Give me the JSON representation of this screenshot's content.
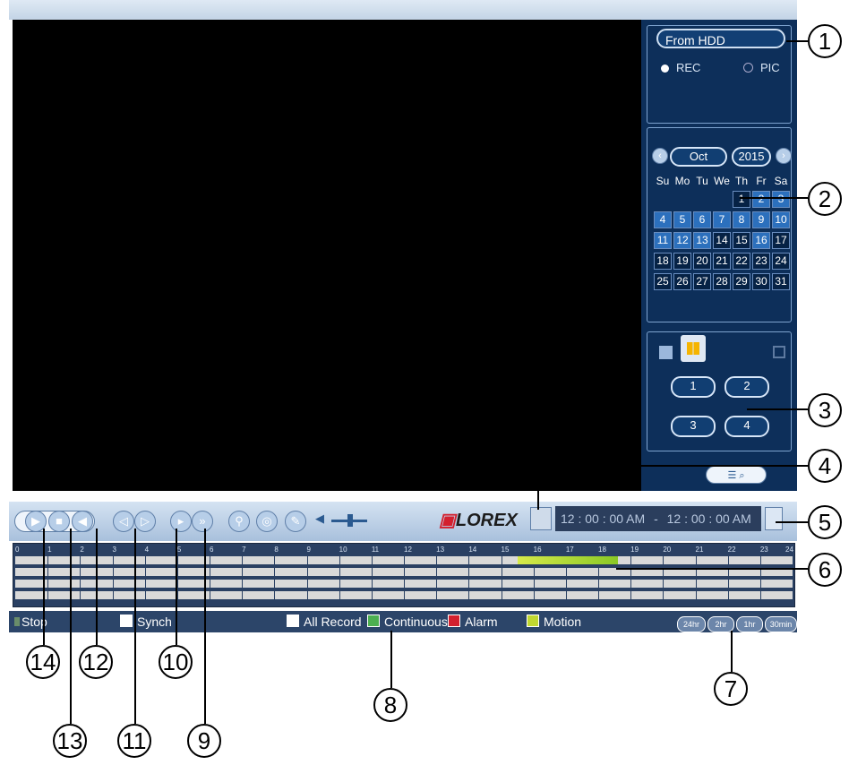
{
  "source": {
    "selected": "From HDD",
    "rec_label": "REC",
    "pic_label": "PIC"
  },
  "calendar": {
    "month": "Oct",
    "year": "2015",
    "weekdays": [
      "Su",
      "Mo",
      "Tu",
      "We",
      "Th",
      "Fr",
      "Sa"
    ],
    "days": [
      {
        "label": "",
        "recorded": false
      },
      {
        "label": "",
        "recorded": false
      },
      {
        "label": "",
        "recorded": false
      },
      {
        "label": "",
        "recorded": false
      },
      {
        "label": "1",
        "recorded": false
      },
      {
        "label": "2",
        "recorded": true
      },
      {
        "label": "3",
        "recorded": true
      },
      {
        "label": "4",
        "recorded": true
      },
      {
        "label": "5",
        "recorded": true
      },
      {
        "label": "6",
        "recorded": true
      },
      {
        "label": "7",
        "recorded": true
      },
      {
        "label": "8",
        "recorded": true
      },
      {
        "label": "9",
        "recorded": true
      },
      {
        "label": "10",
        "recorded": true
      },
      {
        "label": "11",
        "recorded": true
      },
      {
        "label": "12",
        "recorded": true
      },
      {
        "label": "13",
        "recorded": true
      },
      {
        "label": "14",
        "recorded": false
      },
      {
        "label": "15",
        "recorded": false
      },
      {
        "label": "16",
        "recorded": true
      },
      {
        "label": "17",
        "recorded": false
      },
      {
        "label": "18",
        "recorded": false
      },
      {
        "label": "19",
        "recorded": false
      },
      {
        "label": "20",
        "recorded": false
      },
      {
        "label": "21",
        "recorded": false
      },
      {
        "label": "22",
        "recorded": false
      },
      {
        "label": "23",
        "recorded": false
      },
      {
        "label": "24",
        "recorded": false
      },
      {
        "label": "25",
        "recorded": false
      },
      {
        "label": "26",
        "recorded": false
      },
      {
        "label": "27",
        "recorded": false
      },
      {
        "label": "28",
        "recorded": false
      },
      {
        "label": "29",
        "recorded": false
      },
      {
        "label": "30",
        "recorded": false
      },
      {
        "label": "31",
        "recorded": false
      }
    ]
  },
  "channels": {
    "ch1": "1",
    "ch2": "2",
    "ch3": "3",
    "ch4": "4"
  },
  "time": {
    "start": "12 : 00 : 00 AM",
    "end": "12 : 00 : 00 AM"
  },
  "brand": {
    "logo": "LOREX"
  },
  "timeline": {
    "hours": [
      "0",
      "1",
      "2",
      "3",
      "4",
      "5",
      "6",
      "7",
      "8",
      "9",
      "10",
      "11",
      "12",
      "13",
      "14",
      "15",
      "16",
      "17",
      "18",
      "19",
      "20",
      "21",
      "22",
      "23",
      "24"
    ],
    "recording_start_hour": 15.5,
    "recording_end_hour": 18.6
  },
  "legend": {
    "status": "Stop",
    "synch": "Synch",
    "all_record": "All Record",
    "continuous": "Continuous",
    "alarm": "Alarm",
    "motion": "Motion"
  },
  "zoom": [
    "24hr",
    "2hr",
    "1hr",
    "30min"
  ],
  "callouts": [
    "1",
    "2",
    "3",
    "4",
    "5",
    "6",
    "7",
    "8",
    "9",
    "10",
    "11",
    "12",
    "13",
    "14"
  ],
  "colors": {
    "background": "#000000",
    "panel": "#0d2f5a",
    "accent": "#2c70bd",
    "recording": "#8ac926",
    "alarm": "#d3202e"
  }
}
